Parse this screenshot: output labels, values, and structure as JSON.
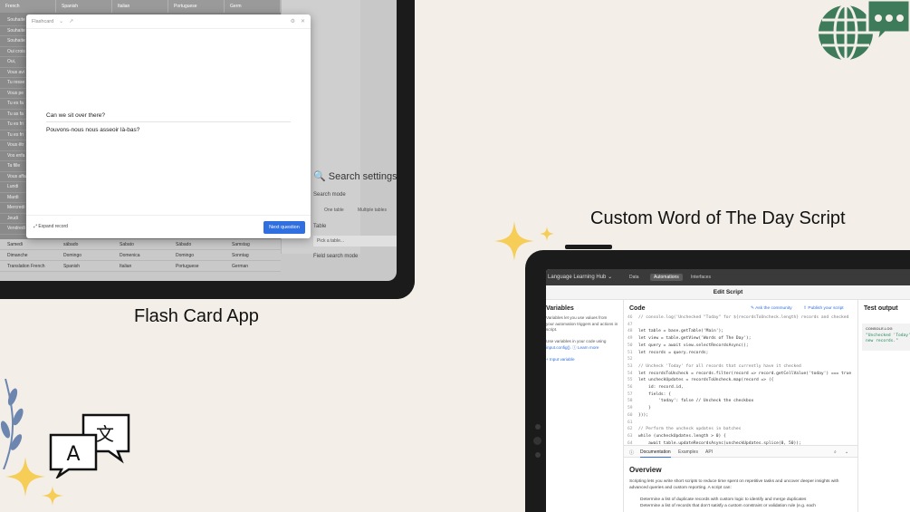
{
  "flash_app": {
    "caption": "Flash Card App",
    "grid_headers": [
      "French",
      "Spanish",
      "Italian",
      "Portuguese",
      "Germ"
    ],
    "left_rows": [
      "Souhaite",
      "Souhaite",
      "Souhaite",
      "Oui crois",
      "Oui,",
      "Vous avi",
      "Tu resse",
      "Vous pe",
      "Tu es fa",
      "Tu as fa",
      "Tu es fri",
      "Tu es fri",
      "Vous êtr",
      "Vos enfa",
      "Ta fille",
      "Vous affa",
      "Lundi",
      "Mardi",
      "Mercredi",
      "Jeudi",
      "Vendredi"
    ],
    "bottom_rows": [
      [
        "Samedi",
        "sábado",
        "Sabato",
        "Sábado",
        "Samstag"
      ],
      [
        "Dimanche",
        "Domingo",
        "Domenica",
        "Domingo",
        "Sonntag"
      ],
      [
        "Translation French",
        "Spanish",
        "Italian",
        "Portuguese",
        "German"
      ]
    ],
    "search": {
      "title": "Search settings",
      "mode_label": "Search mode",
      "one_table": "One table",
      "multiple_tables": "Multiple tables",
      "table_label": "Table",
      "pick_table": "Pick a table...",
      "field_mode": "Field search mode"
    },
    "modal": {
      "title": "Flashcard",
      "question": "Can we sit over there?",
      "answer": "Pouvons-nous nous asseoir là-bas?",
      "expand_label": "Expand record",
      "next_button": "Next question"
    }
  },
  "script_app": {
    "caption": "Custom Word of The Day Script",
    "base_name": "Language Learning Hub",
    "tabs": [
      "Data",
      "Automations",
      "Interfaces"
    ],
    "active_tab": "Automations",
    "page_title": "Edit Script",
    "variables": {
      "title": "Variables",
      "text": [
        "Variables let you use values from",
        "your automation triggers and actions in",
        "script.",
        "",
        "Use variables in your code using",
        "input.config(). ⓘ Learn more",
        "",
        "+ Input variable"
      ]
    },
    "code": {
      "title": "Code",
      "ask_link": "Ask the community",
      "publish_link": "Publish your script",
      "lines": [
        {
          "n": "46",
          "t": "// console.log('Unchecked \"Today\" for ${recordsToUncheck.length} records and checked"
        },
        {
          "n": "47",
          "t": ""
        },
        {
          "n": "48",
          "t": "let table = base.getTable('Main');"
        },
        {
          "n": "49",
          "t": "let view = table.getView('Words of The Day');"
        },
        {
          "n": "50",
          "t": "let query = await view.selectRecordsAsync();"
        },
        {
          "n": "51",
          "t": "let records = query.records;"
        },
        {
          "n": "52",
          "t": ""
        },
        {
          "n": "53",
          "t": "// Uncheck 'Today' for all records that currently have it checked"
        },
        {
          "n": "54",
          "t": "let recordsToUncheck = records.filter(record => record.getCellValue('today') === true"
        },
        {
          "n": "55",
          "t": "let uncheckUpdates = recordsToUncheck.map(record => ({"
        },
        {
          "n": "56",
          "t": "    id: record.id,"
        },
        {
          "n": "57",
          "t": "    fields: {"
        },
        {
          "n": "58",
          "t": "        'today': false // Uncheck the checkbox"
        },
        {
          "n": "59",
          "t": "    }"
        },
        {
          "n": "60",
          "t": "}));"
        },
        {
          "n": "61",
          "t": ""
        },
        {
          "n": "62",
          "t": "// Perform the uncheck updates in batches"
        },
        {
          "n": "63",
          "t": "while (uncheckUpdates.length > 0) {"
        },
        {
          "n": "64",
          "t": "    await table.updateRecordsAsync(uncheckUpdates.splice(0, 50));"
        },
        {
          "n": "65",
          "t": "}"
        },
        {
          "n": "66",
          "t": ""
        },
        {
          "n": "67",
          "t": "// Function to shuffle array (Fisher-Yates shuffle)"
        }
      ]
    },
    "docs": {
      "tabs": [
        "Documentation",
        "Examples",
        "API"
      ],
      "overview_title": "Overview",
      "overview_text": "Scripting lets you write short scripts to reduce time spent on repetitive tasks and uncover deeper insights with advanced queries and custom reporting. A script can:",
      "bullets": [
        "Determine a list of duplicate records with custom logic to identify and merge duplicates",
        "Determine a list of records that don't satisfy a custom constraint or validation rule (e.g. each"
      ]
    },
    "test": {
      "title": "Test output",
      "console": "CONSOLE.LOG",
      "output": "\"Unchecked 'Today' fo\nnew records.\""
    }
  },
  "colors": {
    "accent_blue": "#2f6fe0",
    "globe_green": "#3e7b5a",
    "spark_yellow": "#f5cd57"
  }
}
